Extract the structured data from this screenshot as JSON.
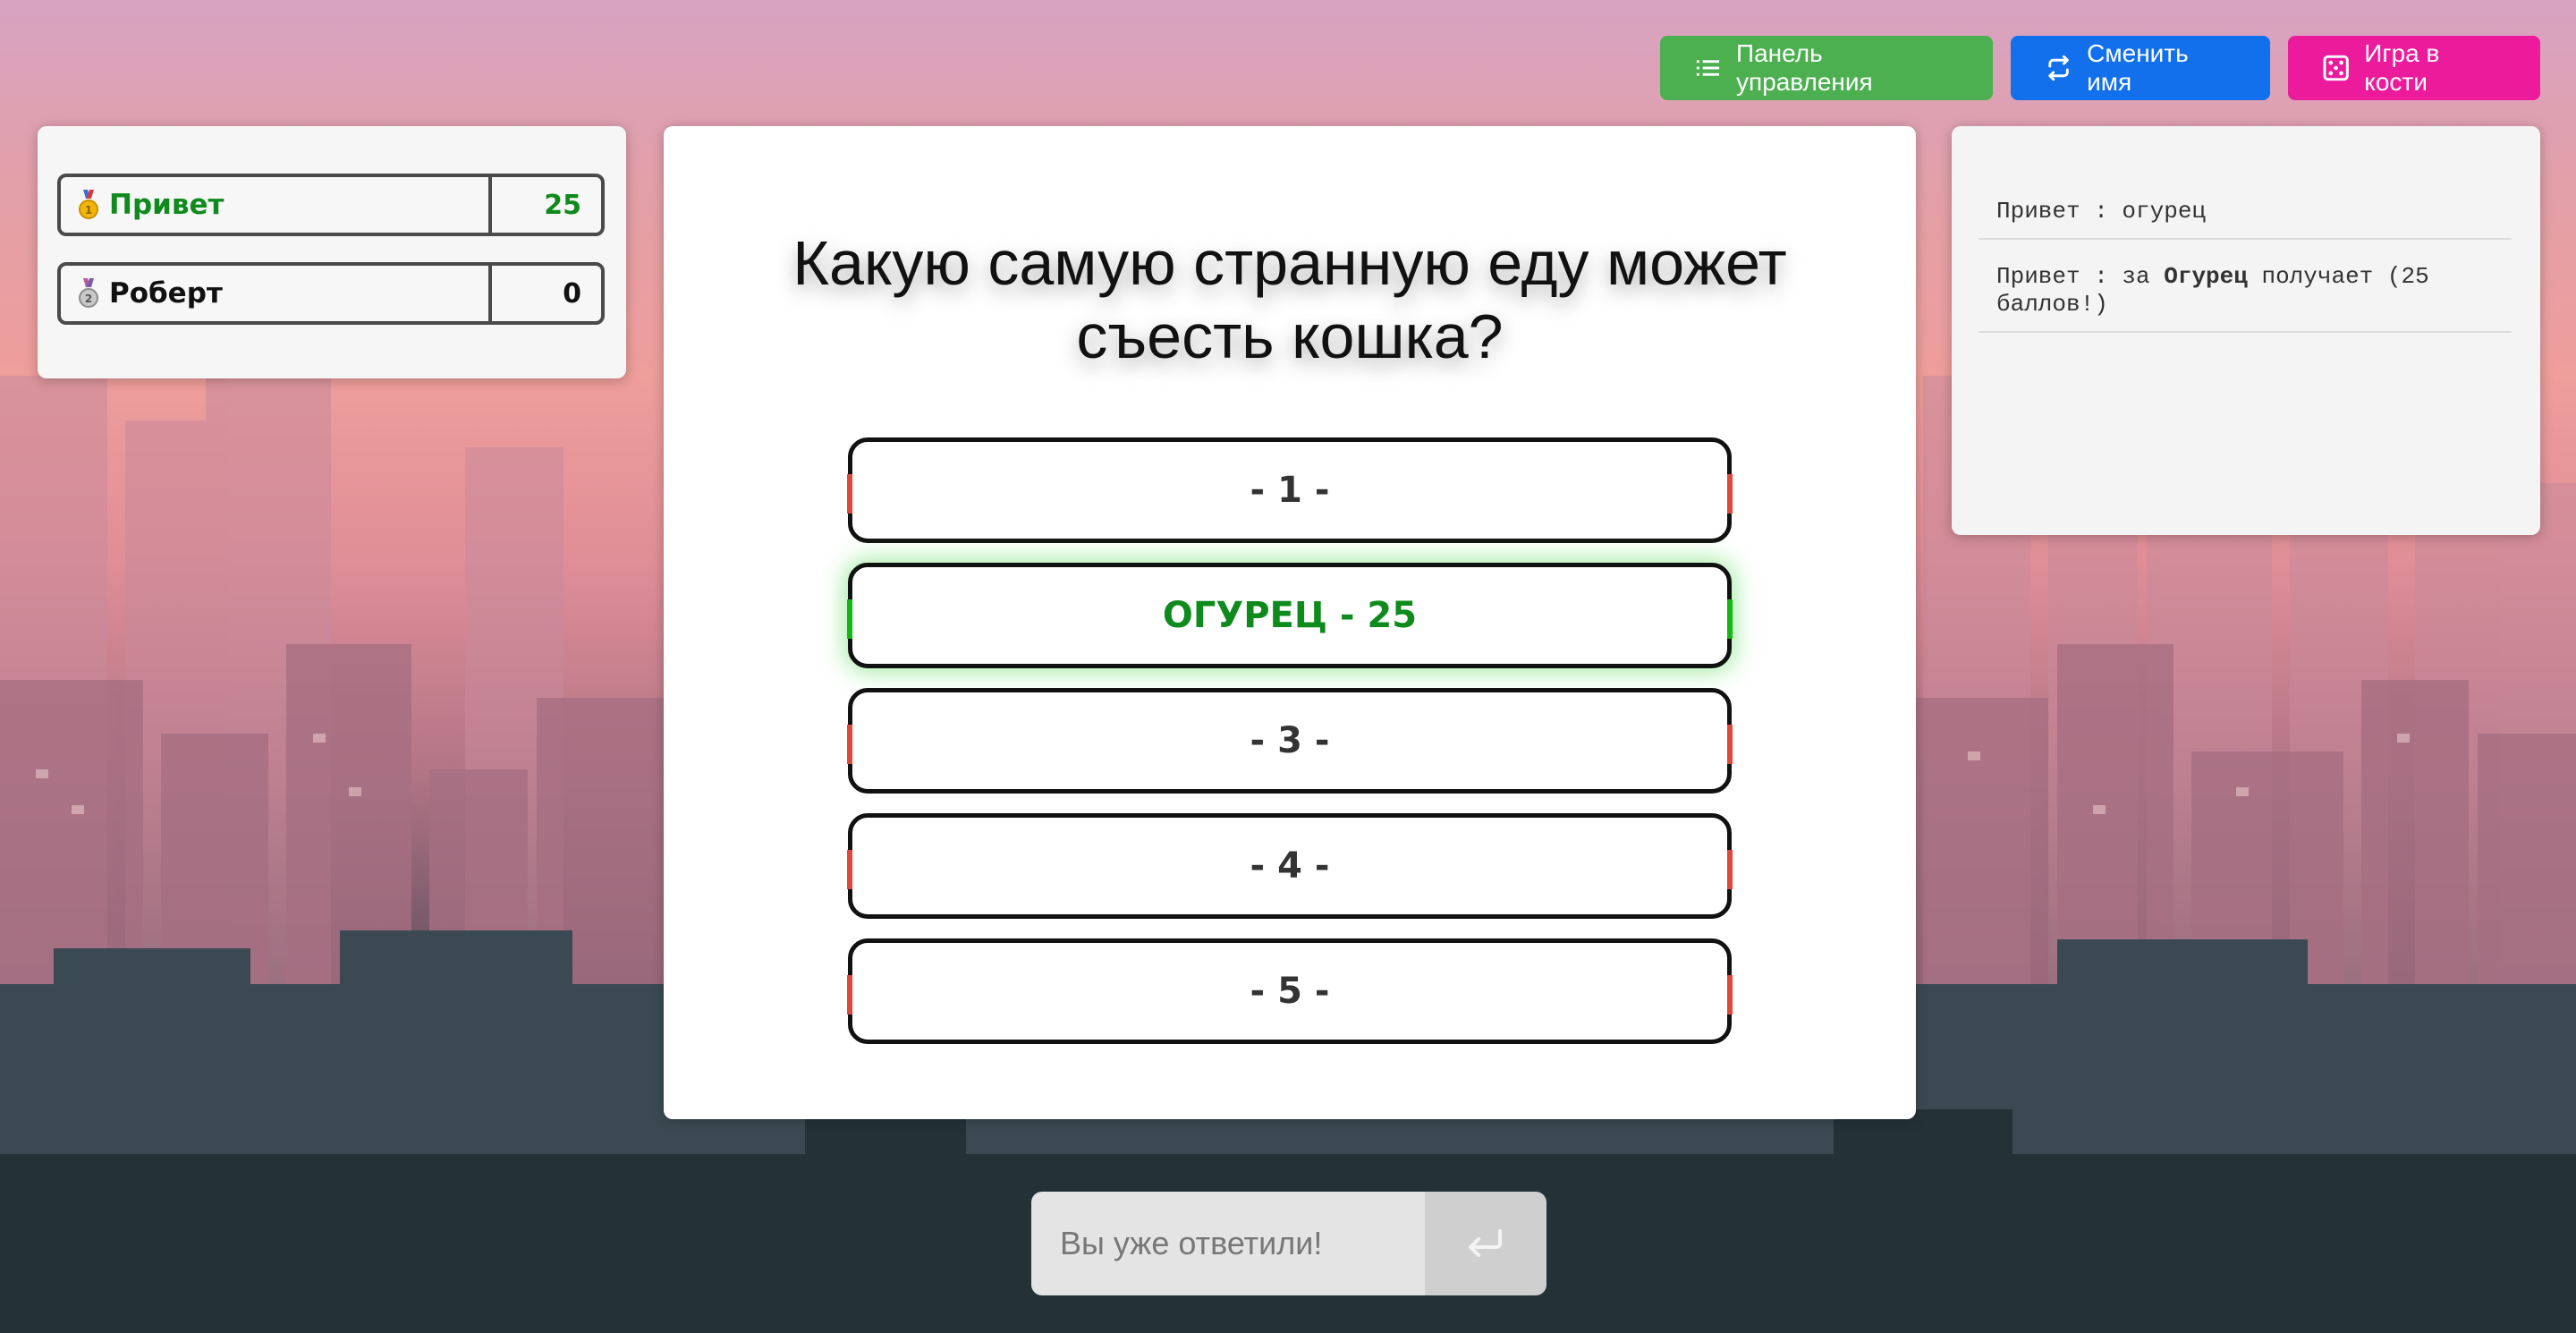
{
  "toolbar": {
    "control_panel_label": "Панель управления",
    "change_name_label": "Сменить имя",
    "dice_game_label": "Игра в кости"
  },
  "scoreboard": {
    "players": [
      {
        "name": "Привет",
        "score": "25",
        "medal": "gold-medal-icon",
        "name_color": "#0f8a1c"
      },
      {
        "name": "Роберт",
        "score": "0",
        "medal": "silver-medal-icon",
        "name_color": "#111111"
      }
    ]
  },
  "question": {
    "text": "Какую самую странную еду может съесть кошка?",
    "answers": [
      {
        "label": "- 1 -",
        "revealed": false
      },
      {
        "label": "ОГУРЕЦ - 25",
        "revealed": true
      },
      {
        "label": "- 3 -",
        "revealed": false
      },
      {
        "label": "- 4 -",
        "revealed": false
      },
      {
        "label": "- 5 -",
        "revealed": false
      }
    ]
  },
  "log": {
    "entries": [
      {
        "prefix": "Привет : огурец",
        "bold": "",
        "suffix": ""
      },
      {
        "prefix": "Привет : за ",
        "bold": "Огурец",
        "suffix": " получает (25 баллов!)"
      }
    ]
  },
  "answer_box": {
    "placeholder": "Вы уже ответили!"
  },
  "colors": {
    "panel_button": "#4caf50",
    "name_button": "#1270ec",
    "dice_button": "#ec1b9b",
    "correct_answer": "#0f8a1c",
    "answer_marker": "#e0483a"
  }
}
